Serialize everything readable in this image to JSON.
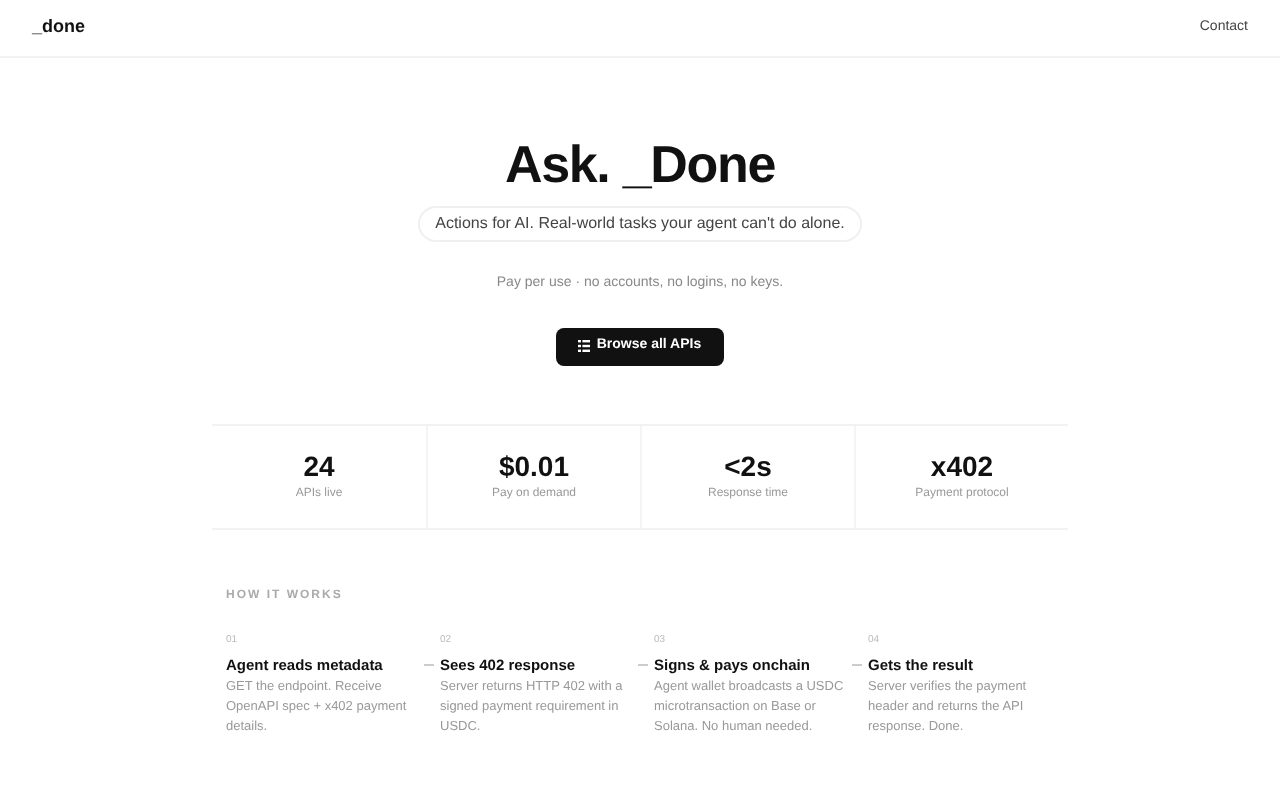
{
  "header": {
    "logo": "_done",
    "nav": [
      "Contact"
    ]
  },
  "hero": {
    "title": "Ask. _Done",
    "tagline": "Actions for AI. Real-world tasks your agent can't do alone.",
    "note": "Pay per use · no accounts, no logins, no keys.",
    "button": "Browse all APIs"
  },
  "stats": [
    {
      "value": "24",
      "label": "APIs live"
    },
    {
      "value": "$0.01",
      "label": "Pay on demand"
    },
    {
      "value": "<2s",
      "label": "Response time"
    },
    {
      "value": "x402",
      "label": "Payment protocol"
    }
  ],
  "how_it_works": {
    "heading": "HOW IT WORKS",
    "steps": [
      {
        "number": "01",
        "title": "Agent reads metadata",
        "text": "GET the endpoint. Receive OpenAPI spec + x402 payment details."
      },
      {
        "number": "02",
        "title": "Sees 402 response",
        "text": "Server returns HTTP 402 with a signed payment requirement in USDC."
      },
      {
        "number": "03",
        "title": "Signs & pays onchain",
        "text": "Agent wallet broadcasts a USDC microtransaction on Base or Solana. No human needed."
      },
      {
        "number": "04",
        "title": "Gets the result",
        "text": "Server verifies the payment header and returns the API response. Done."
      }
    ]
  }
}
